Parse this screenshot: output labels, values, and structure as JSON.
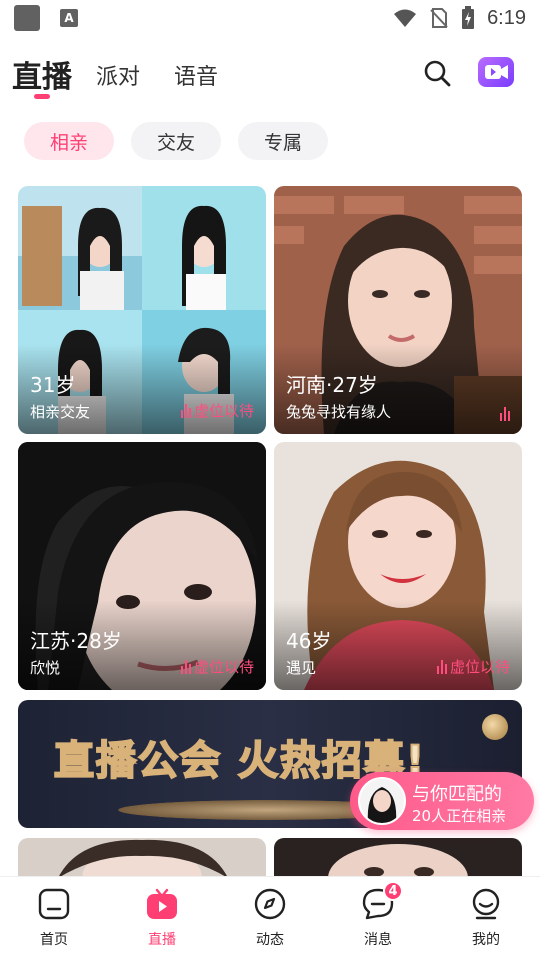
{
  "status_bar": {
    "time": "6:19"
  },
  "header": {
    "tabs": [
      {
        "label": "直播",
        "active": true
      },
      {
        "label": "派对",
        "active": false
      },
      {
        "label": "语音",
        "active": false
      }
    ]
  },
  "filters": [
    {
      "label": "相亲",
      "active": true
    },
    {
      "label": "交友",
      "active": false
    },
    {
      "label": "专属",
      "active": false
    }
  ],
  "cards": [
    {
      "title": "31岁",
      "subtitle": "相亲交友",
      "status": "虚位以待",
      "photo_icon": "collage-portrait"
    },
    {
      "title": "河南·27岁",
      "subtitle": "兔兔寻找有缘人",
      "status": "",
      "photo_icon": "portrait"
    },
    {
      "title": "江苏·28岁",
      "subtitle": "欣悦",
      "status": "虚位以待",
      "photo_icon": "portrait"
    },
    {
      "title": "46岁",
      "subtitle": "遇见",
      "status": "虚位以待",
      "photo_icon": "portrait"
    }
  ],
  "banner": {
    "text": "直播公会 火热招募!"
  },
  "match_popup": {
    "title": "与你匹配的",
    "subtitle": "20人正在相亲"
  },
  "bottom_nav": [
    {
      "label": "首页",
      "active": false
    },
    {
      "label": "直播",
      "active": true
    },
    {
      "label": "动态",
      "active": false
    },
    {
      "label": "消息",
      "active": false,
      "badge": "4"
    },
    {
      "label": "我的",
      "active": false
    }
  ],
  "colors": {
    "accent": "#ff3f73",
    "chip_bg": "#f3f3f5",
    "chip_active_bg": "#ffe6ec"
  }
}
